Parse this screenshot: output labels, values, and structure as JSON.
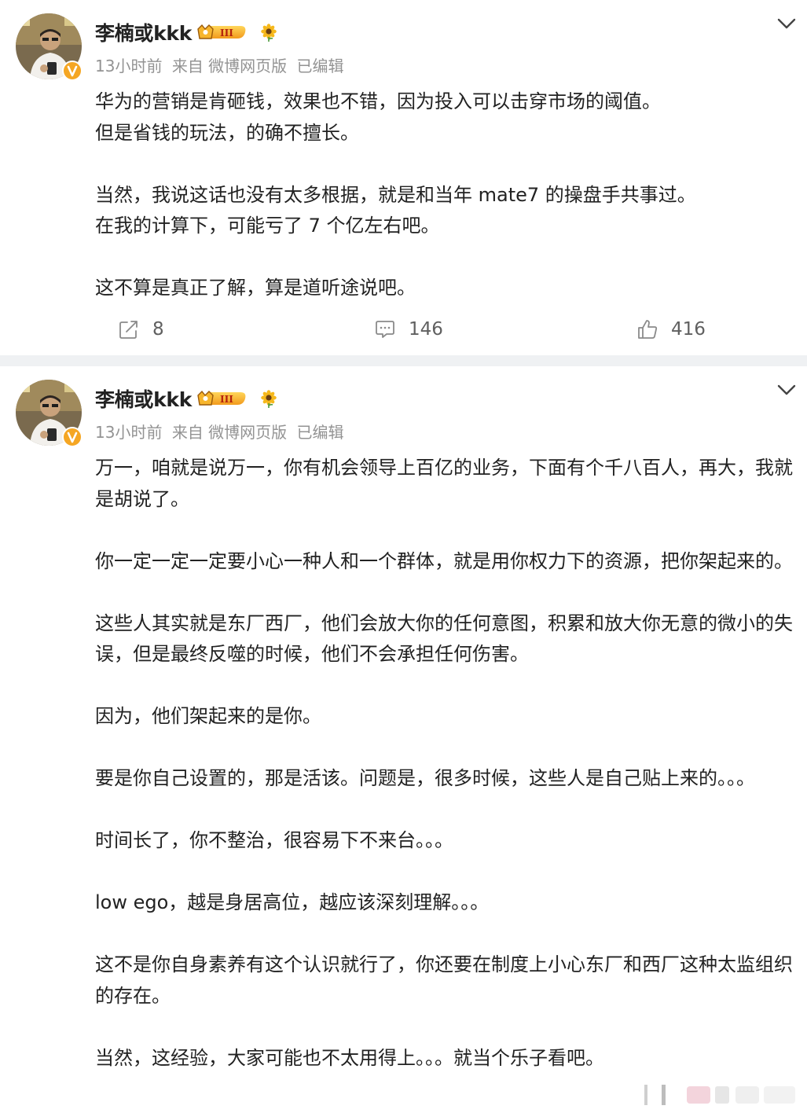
{
  "posts": [
    {
      "user": {
        "name": "李楠或kkk",
        "level_badge": "III"
      },
      "meta": {
        "time": "13小时前",
        "source": "来自 微博网页版",
        "edited": "已编辑"
      },
      "content": [
        "华为的营销是肯砸钱，效果也不错，因为投入可以击穿市场的阈值。",
        "但是省钱的玩法，的确不擅长。",
        "",
        "当然，我说这话也没有太多根据，就是和当年 mate7 的操盘手共事过。",
        "在我的计算下，可能亏了 7 个亿左右吧。",
        "",
        "这不算是真正了解，算是道听途说吧。"
      ],
      "actions": {
        "repost_count": "8",
        "comment_count": "146",
        "like_count": "416"
      }
    },
    {
      "user": {
        "name": "李楠或kkk",
        "level_badge": "III"
      },
      "meta": {
        "time": "13小时前",
        "source": "来自 微博网页版",
        "edited": "已编辑"
      },
      "content": [
        "万一，咱就是说万一，你有机会领导上百亿的业务，下面有个千八百人，再大，我就是胡说了。",
        "",
        "你一定一定一定要小心一种人和一个群体，就是用你权力下的资源，把你架起来的。",
        "",
        "这些人其实就是东厂西厂，他们会放大你的任何意图，积累和放大你无意的微小的失误，但是最终反噬的时候，他们不会承担任何伤害。",
        "",
        "因为，他们架起来的是你。",
        "",
        "要是你自己设置的，那是活该。问题是，很多时候，这些人是自己贴上来的。。。",
        "",
        "时间长了，你不整治，很容易下不来台。。。",
        "",
        "low ego，越是身居高位，越应该深刻理解。。。",
        "",
        "这不是你自身素养有这个认识就行了，你还要在制度上小心东厂和西厂这种太监组织的存在。",
        "",
        "当然，这经验，大家可能也不太用得上。。。就当个乐子看吧。"
      ]
    }
  ]
}
